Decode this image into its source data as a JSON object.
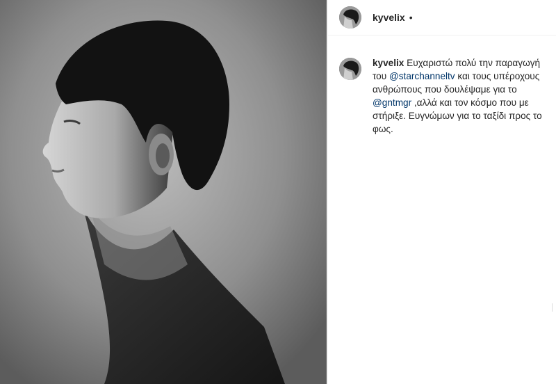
{
  "post": {
    "username": "kyvelix",
    "separator": "•",
    "image": "post-photo"
  },
  "caption": {
    "username": "kyvelix",
    "part1": " Ευχαριστώ πολύ την παραγωγή του ",
    "mention1": "@starchanneltv",
    "part2": " και τους υπέροχους ανθρώπους που δουλέψαμε για το ",
    "mention2": "@gntmgr",
    "part3": " ,αλλά και τον κόσμο που με στήριξε. Ευγνώμων για το ταξίδι προς το φως."
  },
  "colors": {
    "text": "#262626",
    "mention": "#003569",
    "border": "#efefef"
  }
}
